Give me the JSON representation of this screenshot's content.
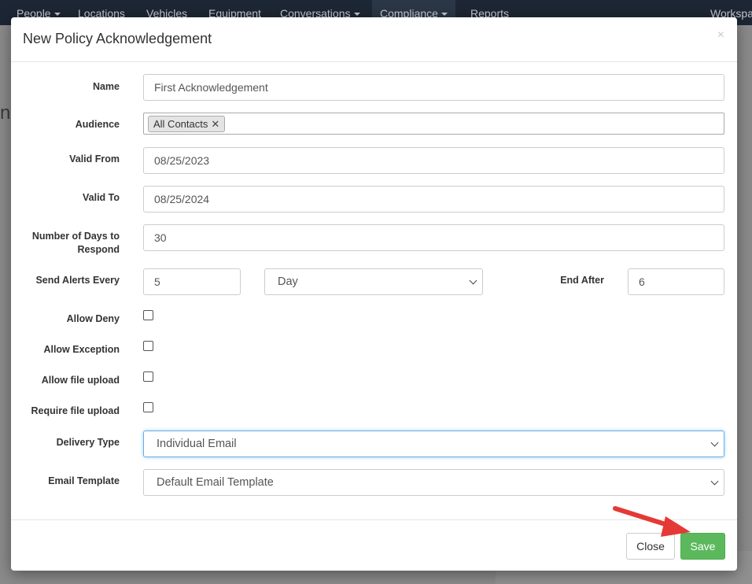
{
  "nav": {
    "items": [
      "People",
      "Locations",
      "Vehicles",
      "Equipment",
      "Conversations",
      "Compliance",
      "Reports",
      "Workspa"
    ]
  },
  "background": {
    "partial_text": "nc"
  },
  "modal": {
    "title": "New Policy Acknowledgement",
    "close_glyph": "×",
    "fields": {
      "name_label": "Name",
      "name_value": "First Acknowledgement",
      "audience_label": "Audience",
      "audience_tag": "All Contacts",
      "audience_tag_remove": "✕",
      "valid_from_label": "Valid From",
      "valid_from_value": "08/25/2023",
      "valid_to_label": "Valid To",
      "valid_to_value": "08/25/2024",
      "days_label": "Number of Days to Respond",
      "days_value": "30",
      "alerts_label": "Send Alerts Every",
      "alerts_value": "5",
      "alerts_unit": "Day",
      "end_after_label": "End After",
      "end_after_value": "6",
      "allow_deny_label": "Allow Deny",
      "allow_exception_label": "Allow Exception",
      "allow_upload_label": "Allow file upload",
      "require_upload_label": "Require file upload",
      "delivery_label": "Delivery Type",
      "delivery_value": "Individual Email",
      "template_label": "Email Template",
      "template_value": "Default Email Template"
    },
    "footer": {
      "close_label": "Close",
      "save_label": "Save"
    }
  },
  "colors": {
    "save_green": "#5cb85c",
    "annotation_arrow": "#e53935",
    "nav_bg": "#1d2634"
  }
}
